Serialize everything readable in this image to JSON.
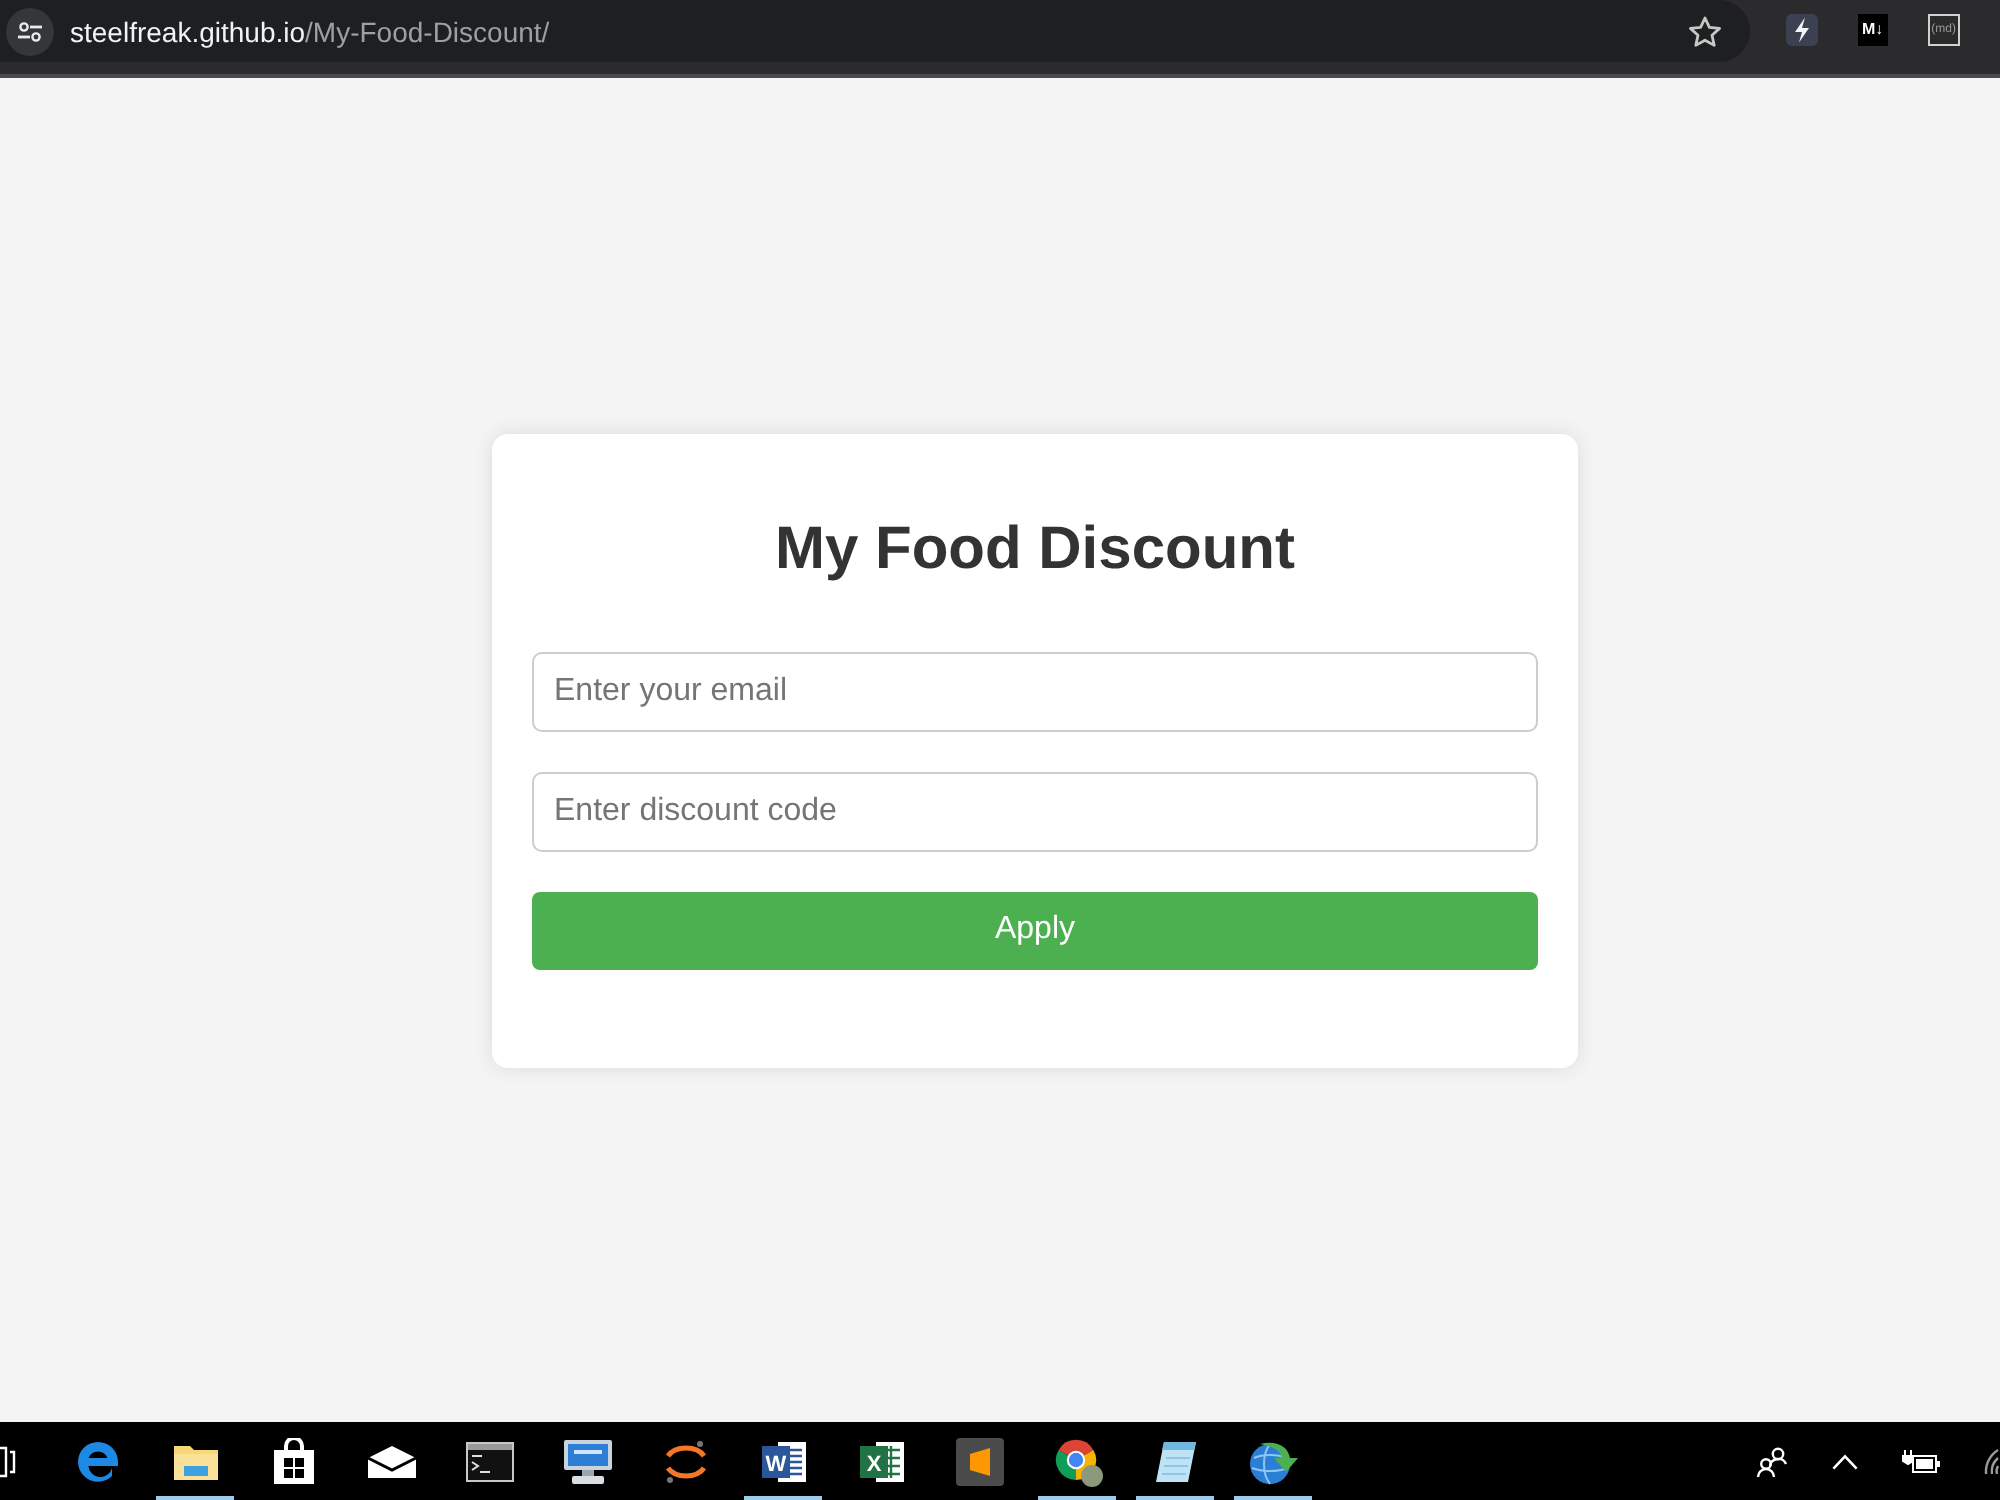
{
  "browser": {
    "address": {
      "host": "steelfreak.github.io",
      "path": "/My-Food-Discount/",
      "bookmarked": false
    },
    "extensions": [
      {
        "kind": "bolt"
      },
      {
        "kind": "dark-tile",
        "label": "M↓"
      },
      {
        "kind": "outlined-tile",
        "label": "(md)"
      }
    ]
  },
  "form": {
    "title": "My Food Discount",
    "fields": [
      {
        "placeholder": "Enter your email"
      },
      {
        "placeholder": "Enter discount code"
      }
    ],
    "submit": "Apply"
  },
  "taskbar": {
    "apps": [
      {
        "kind": "e-logo",
        "running": false
      },
      {
        "kind": "folder",
        "running": true
      },
      {
        "kind": "bag",
        "running": false
      },
      {
        "kind": "envelope",
        "running": false
      },
      {
        "kind": "terminal",
        "running": false
      },
      {
        "kind": "computer",
        "running": false
      },
      {
        "kind": "orbit",
        "running": false
      },
      {
        "kind": "letter-doc",
        "label": "W",
        "running": true
      },
      {
        "kind": "letter-sheet",
        "label": "X",
        "running": false
      },
      {
        "kind": "s-tile",
        "running": false
      },
      {
        "kind": "segmented-circle",
        "running": true
      },
      {
        "kind": "notepad",
        "running": true
      },
      {
        "kind": "globe-arrow",
        "running": true
      }
    ],
    "tray": [
      {
        "kind": "people"
      },
      {
        "kind": "chevron"
      },
      {
        "kind": "battery"
      },
      {
        "kind": "wifi"
      }
    ]
  }
}
